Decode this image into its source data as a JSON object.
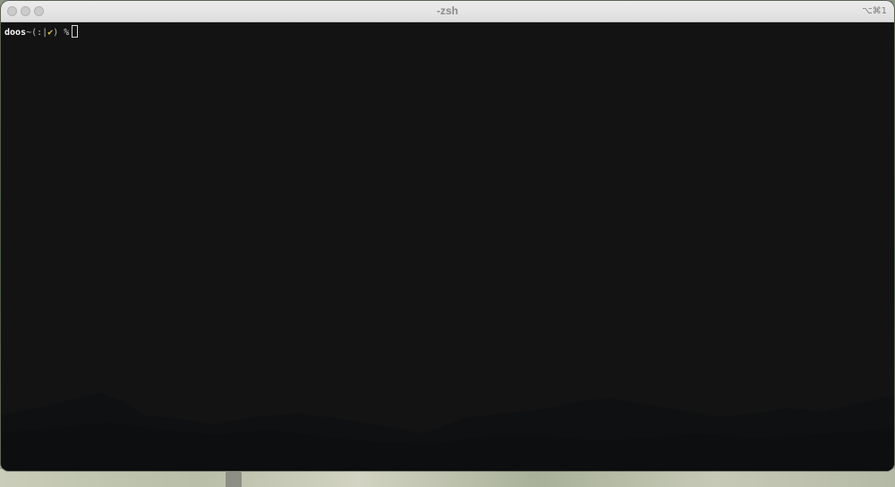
{
  "window": {
    "title": "-zsh",
    "shortcut": "⌥⌘1"
  },
  "terminal": {
    "prompt": {
      "user": "doos",
      "separator": "~",
      "git_open": "(:",
      "git_branch": "|",
      "git_status": "✔",
      "git_close": ")",
      "symbol": " %"
    }
  },
  "colors": {
    "terminal_background": "#131313",
    "prompt_user": "#ffffff",
    "git_status": "#d8c35a"
  },
  "icons": {
    "close": "close-icon",
    "minimize": "minimize-icon",
    "zoom": "zoom-icon"
  }
}
